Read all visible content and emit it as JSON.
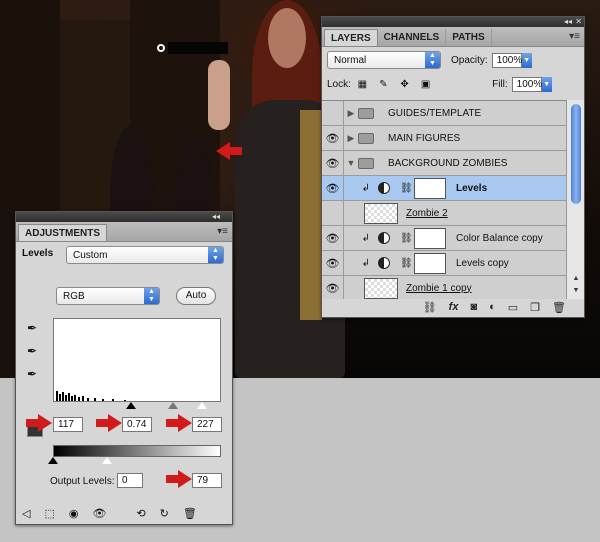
{
  "layers_panel": {
    "tabs": [
      {
        "label": "LAYERS",
        "active": true
      },
      {
        "label": "CHANNELS",
        "active": false
      },
      {
        "label": "PATHS",
        "active": false
      }
    ],
    "blend_mode": "Normal",
    "opacity_label": "Opacity:",
    "opacity_value": "100%",
    "lock_label": "Lock:",
    "fill_label": "Fill:",
    "fill_value": "100%",
    "rows": [
      {
        "name": "GUIDES/TEMPLATE",
        "type": "group",
        "visible": false,
        "expanded": false
      },
      {
        "name": "MAIN FIGURES",
        "type": "group",
        "visible": true,
        "expanded": false
      },
      {
        "name": "BACKGROUND ZOMBIES",
        "type": "group",
        "visible": true,
        "expanded": true
      },
      {
        "name": "Levels",
        "type": "adjustment",
        "visible": true,
        "selected": true
      },
      {
        "name": "Zombie 2",
        "type": "pixel",
        "visible": true
      },
      {
        "name": "Color Balance copy",
        "type": "adjustment",
        "visible": true
      },
      {
        "name": "Levels copy",
        "type": "adjustment",
        "visible": true
      },
      {
        "name": "Zombie 1 copy",
        "type": "pixel",
        "visible": true
      }
    ]
  },
  "adjustments_panel": {
    "tab": "ADJUSTMENTS",
    "preset_label": "Levels",
    "preset_value": "Custom",
    "channel_value": "RGB",
    "auto_label": "Auto",
    "input_black": "117",
    "input_gamma": "0.74",
    "input_white": "227",
    "output_label": "Output Levels:",
    "output_black": "0",
    "output_white": "79"
  },
  "icons": {
    "eye": "eye-icon",
    "folder": "folder-icon",
    "chain": "chain-link-icon",
    "eyedropper": "eyedropper-icon",
    "trash": "trash-icon"
  },
  "colors": {
    "accent_red_arrow": "#d11a1a",
    "selected_row": "#a9c8ef",
    "scrollbar_blue": "#4b82d8"
  }
}
